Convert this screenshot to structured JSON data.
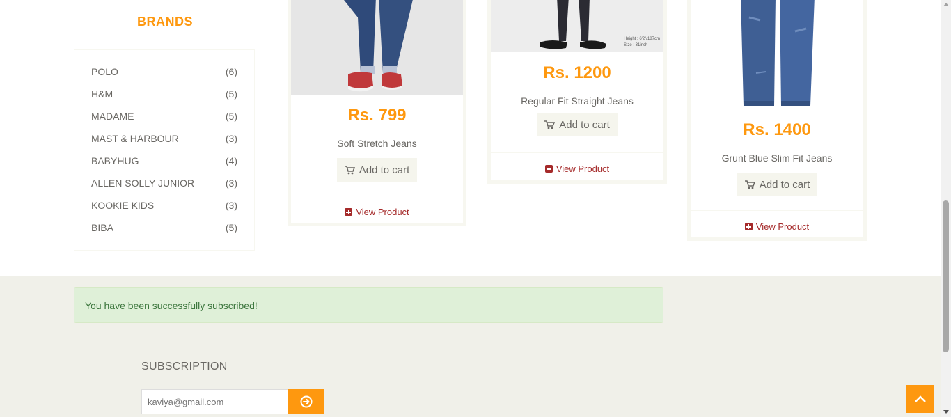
{
  "sidebar": {
    "brands_title": "BRANDS",
    "brands": [
      {
        "name": "POLO",
        "count": "(6)"
      },
      {
        "name": "H&M",
        "count": "(5)"
      },
      {
        "name": "MADAME",
        "count": "(5)"
      },
      {
        "name": "MAST & HARBOUR",
        "count": "(3)"
      },
      {
        "name": "BABYHUG",
        "count": "(4)"
      },
      {
        "name": "ALLEN SOLLY JUNIOR",
        "count": "(3)"
      },
      {
        "name": "KOOKIE KIDS",
        "count": "(3)"
      },
      {
        "name": "BIBA",
        "count": "(5)"
      }
    ]
  },
  "products": [
    {
      "price": "Rs. 799",
      "name": "Soft Stretch Jeans",
      "add_label": "Add to cart",
      "view_label": "View Product"
    },
    {
      "price": "Rs. 1200",
      "name": "Regular Fit Straight Jeans",
      "add_label": "Add to cart",
      "view_label": "View Product",
      "image_caption": [
        "Height : 6'2\"/187cm",
        "Size : 31inch"
      ]
    },
    {
      "price": "Rs. 1400",
      "name": "Grunt Blue Slim Fit Jeans",
      "add_label": "Add to cart",
      "view_label": "View Product"
    }
  ],
  "alert": {
    "text": "You have been successfully subscribed!"
  },
  "subscription": {
    "title": "SUBSCRIPTION",
    "email_value": "kaviya@gmail.com"
  },
  "colors": {
    "accent": "#FE980F",
    "link": "#a52a2a",
    "footer_bg": "#F0F0E9",
    "alert_bg": "#dff0d8"
  },
  "icons": {
    "cart": "shopping-cart-icon",
    "plus": "plus-square-icon",
    "submit": "arrow-circle-right-icon",
    "scroll": "chevron-up-icon"
  }
}
